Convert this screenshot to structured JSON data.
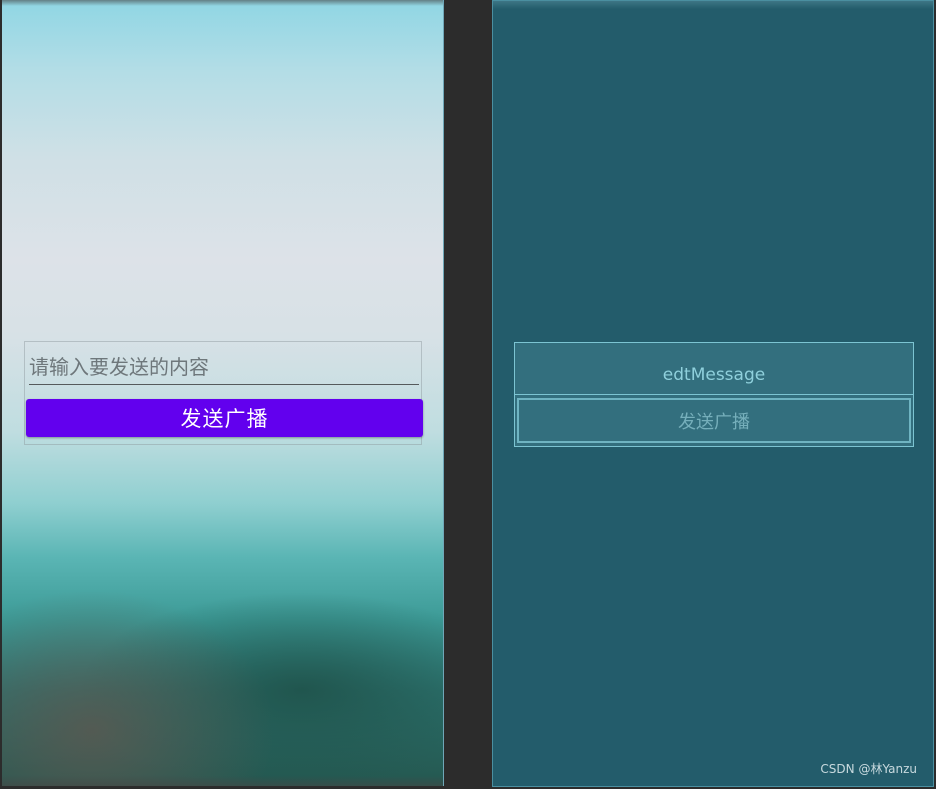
{
  "design_view": {
    "message_input": {
      "placeholder": "请输入要发送的内容",
      "value": ""
    },
    "send_button_label": "发送广播",
    "colors": {
      "button": "#6200ee",
      "button_text": "#ffffff"
    }
  },
  "blueprint_view": {
    "edit_text_id": "edtMessage",
    "button_label": "发送广播",
    "colors": {
      "background": "#235c6b",
      "outline": "#7cc4d2"
    }
  },
  "watermark": "CSDN @林Yanzu"
}
